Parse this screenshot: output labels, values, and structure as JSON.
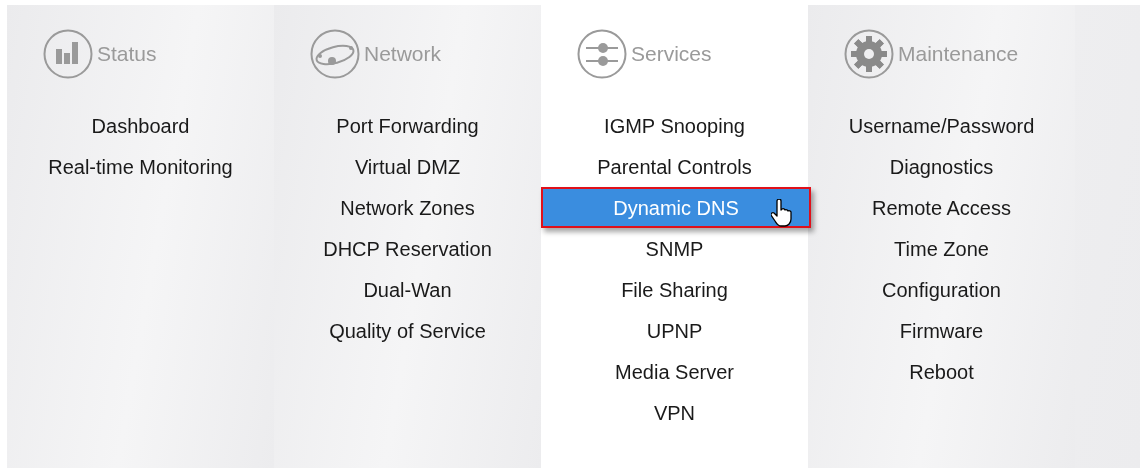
{
  "menu": {
    "columns": [
      {
        "title": "Status",
        "kind": "chart",
        "selected": false,
        "items": [
          {
            "label": "Dashboard",
            "selected": false
          },
          {
            "label": "Real-time Monitoring",
            "selected": false
          }
        ]
      },
      {
        "title": "Network",
        "kind": "network",
        "selected": false,
        "items": [
          {
            "label": "Port Forwarding",
            "selected": false
          },
          {
            "label": "Virtual DMZ",
            "selected": false
          },
          {
            "label": "Network Zones",
            "selected": false
          },
          {
            "label": "DHCP Reservation",
            "selected": false
          },
          {
            "label": "Dual-Wan",
            "selected": false
          },
          {
            "label": "Quality of Service",
            "selected": false
          }
        ]
      },
      {
        "title": "Services",
        "kind": "sliders",
        "selected": true,
        "items": [
          {
            "label": "IGMP Snooping",
            "selected": false
          },
          {
            "label": "Parental Controls",
            "selected": false
          },
          {
            "label": "Dynamic DNS",
            "selected": true
          },
          {
            "label": "SNMP",
            "selected": false
          },
          {
            "label": "File Sharing",
            "selected": false
          },
          {
            "label": "UPNP",
            "selected": false
          },
          {
            "label": "Media Server",
            "selected": false
          },
          {
            "label": "VPN",
            "selected": false
          }
        ]
      },
      {
        "title": "Maintenance",
        "kind": "gear",
        "selected": false,
        "items": [
          {
            "label": "Username/Password",
            "selected": false
          },
          {
            "label": "Diagnostics",
            "selected": false
          },
          {
            "label": "Remote Access",
            "selected": false
          },
          {
            "label": "Time Zone",
            "selected": false
          },
          {
            "label": "Configuration",
            "selected": false
          },
          {
            "label": "Firmware",
            "selected": false
          },
          {
            "label": "Reboot",
            "selected": false
          }
        ]
      }
    ]
  }
}
